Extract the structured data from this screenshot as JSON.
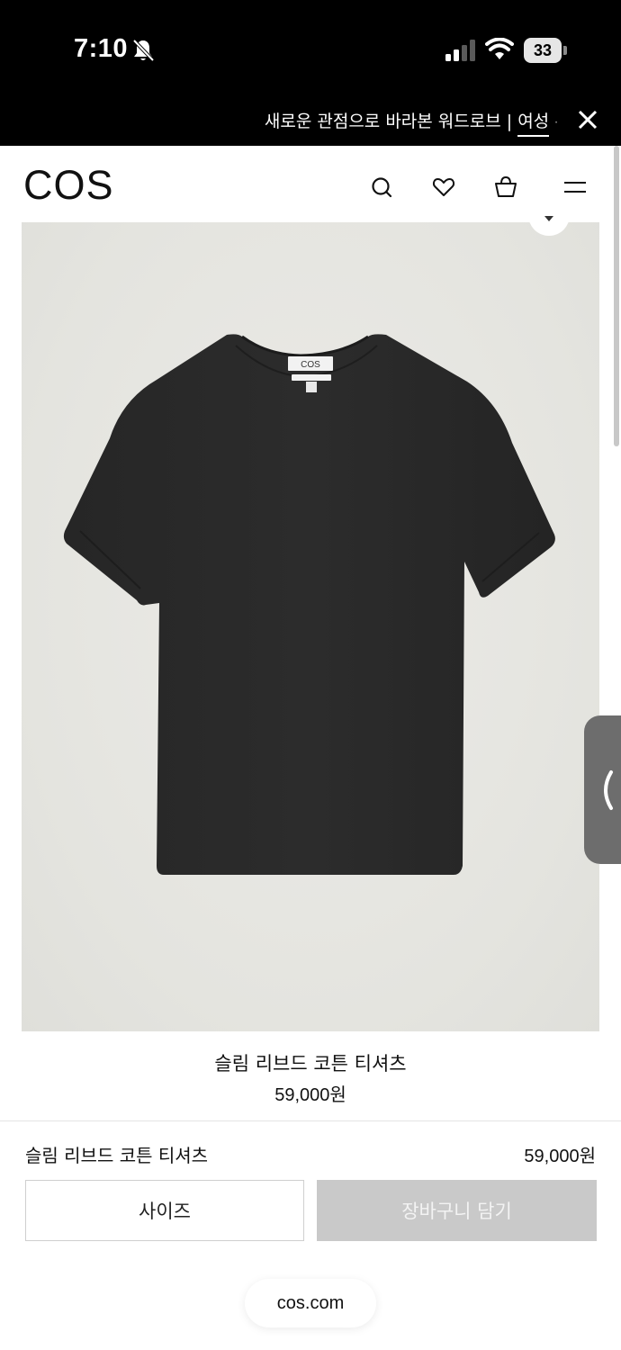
{
  "status_bar": {
    "time": "7:10",
    "battery": "33"
  },
  "announcement": {
    "text": "새로운 관점으로 바라본 워드로브 | ",
    "link": "여성",
    "dot": "·"
  },
  "header": {
    "logo": "COS"
  },
  "product": {
    "name": "슬림 리브드 코튼 티셔츠",
    "price": "59,000원",
    "garment_label": "COS"
  },
  "sticky_bar": {
    "name": "슬림 리브드 코튼 티셔츠",
    "price": "59,000원",
    "size_button": "사이즈",
    "cart_button": "장바구니 담기"
  },
  "browser": {
    "url": "cos.com"
  },
  "colors": {
    "status_bg": "#000000",
    "image_bg": "#e4e4df",
    "cart_disabled": "#c9c9c9",
    "garment": "#222222"
  }
}
